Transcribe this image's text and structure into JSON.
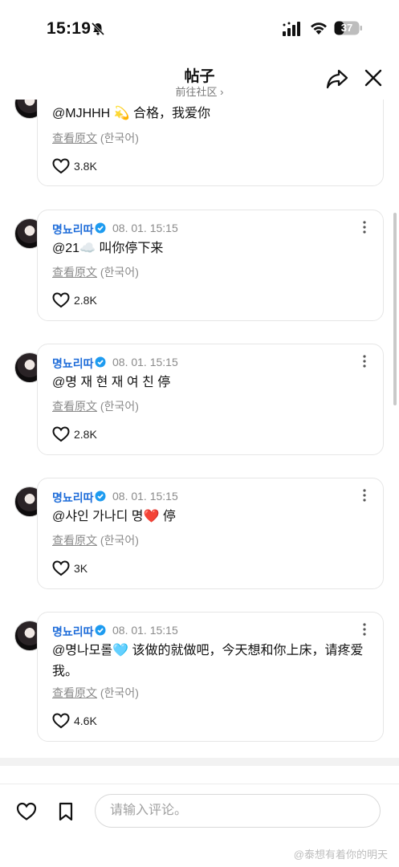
{
  "status_bar": {
    "time": "15:19",
    "battery": "37"
  },
  "header": {
    "title": "帖子",
    "subtitle": "前往社区 ›"
  },
  "comments": [
    {
      "author": "",
      "timestamp": "",
      "text": "@MJHHH 💫 合格，我爱你",
      "translate_link": "查看原文",
      "translate_lang": "(한국어)",
      "likes": "3.8K"
    },
    {
      "author": "명뇨리따",
      "timestamp": "08. 01. 15:15",
      "text": "@21☁️ 叫你停下来",
      "translate_link": "查看原文",
      "translate_lang": "(한국어)",
      "likes": "2.8K"
    },
    {
      "author": "명뇨리따",
      "timestamp": "08. 01. 15:15",
      "text": "@명 재 현 재 여 친 停",
      "translate_link": "查看原文",
      "translate_lang": "(한국어)",
      "likes": "2.8K"
    },
    {
      "author": "명뇨리따",
      "timestamp": "08. 01. 15:15",
      "text": "@샤인 가나디 명❤️ 停",
      "translate_link": "查看原文",
      "translate_lang": "(한국어)",
      "likes": "3K"
    },
    {
      "author": "명뇨리따",
      "timestamp": "08. 01. 15:15",
      "text": "@명나모롤🩵 该做的就做吧，今天想和你上床，请疼爱我。",
      "translate_link": "查看原文",
      "translate_lang": "(한국어)",
      "likes": "4.6K"
    }
  ],
  "bottom_bar": {
    "comment_placeholder": "请输入评论。"
  },
  "watermark": "@泰想有着你的明天",
  "colors": {
    "accent_blue": "#1e6cd9",
    "verified_blue": "#1d9bf0",
    "muted_gray": "#8a8a8a"
  }
}
